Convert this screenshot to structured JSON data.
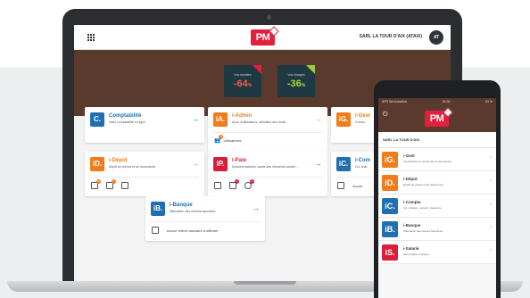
{
  "header": {
    "logo": "PM",
    "company": "SARL LA TOUR D'AIX (ATAIX)",
    "avatar": "AT"
  },
  "hero": {
    "stats": [
      {
        "label": "Vos recettes",
        "value": "-64",
        "unit": "%",
        "color": "#e3203b"
      },
      {
        "label": "Vos charges",
        "value": "-36",
        "unit": "%",
        "color": "#9ccc3a"
      }
    ]
  },
  "cards": {
    "comptabilite": {
      "icon": "C.",
      "title": "Comptabilité",
      "sub": "Votre comptabilité en ligne"
    },
    "iadmin": {
      "icon": "iA.",
      "title": "i-Admin",
      "sub": "Ajout d'utilisateurs, définition des droits",
      "foot": "Utilisateurs",
      "badge": "3"
    },
    "igestion": {
      "icon": "iG.",
      "title": "i-Gest",
      "sub": "Consul"
    },
    "idepot": {
      "icon": "iD.",
      "title": "i-Dépot",
      "sub": "Dépôt de pièces et de documents",
      "badges": [
        "10",
        "1",
        ""
      ]
    },
    "ipaie": {
      "icon": "iP.",
      "title": "i-Paie",
      "sub": "Dossiers salariés, saisie des éléments variabl...",
      "badges": [
        "",
        "1",
        "1"
      ]
    },
    "icompta": {
      "icon": "iC.",
      "title": "i-Com",
      "sub": "CA, char",
      "foot": "Aucun"
    },
    "ibanque": {
      "icon": "iB.",
      "title": "i-Banque",
      "sub": "Affectation des relevés bancaires",
      "foot": "Aucun relevé bancaire à affecter"
    }
  },
  "phone": {
    "status_left": "SFR ServicesMob",
    "status_center": "09:30",
    "status_right": "53 %",
    "logo": "PM",
    "company": "SARL LA TOUR D'AIX",
    "items": [
      {
        "icon": "iG.",
        "title": "i-Gest",
        "sub": "Consultation et recherche de documents",
        "color": "#ef7d1a"
      },
      {
        "icon": "iD.",
        "title": "i-Dépot",
        "sub": "Dépôt de pièces et de documents",
        "color": "#ef7d1a"
      },
      {
        "icon": "iC.",
        "title": "i-Compta",
        "sub": "CA, charges, recours, trésorerie",
        "color": "#1f6fb2"
      },
      {
        "icon": "iB.",
        "title": "i-Banque",
        "sub": "Affectation des relevés bancaires",
        "color": "#1f6fb2"
      },
      {
        "icon": "iS.",
        "title": "i-Salarié",
        "sub": "Mon espace employé",
        "color": "#d91e3a"
      }
    ]
  }
}
